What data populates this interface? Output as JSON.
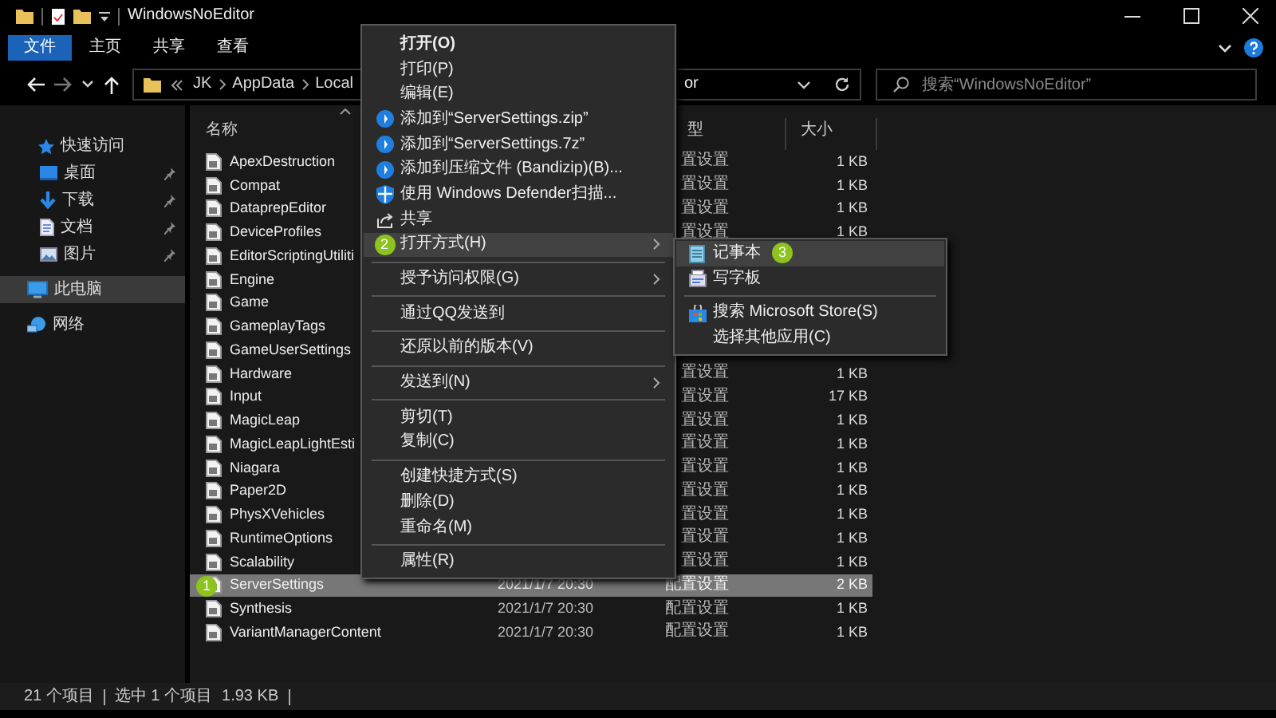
{
  "window": {
    "title": "WindowsNoEditor"
  },
  "ribbon_tabs": [
    {
      "label": "文件",
      "selected": true
    },
    {
      "label": "主页",
      "selected": false
    },
    {
      "label": "共享",
      "selected": false
    },
    {
      "label": "查看",
      "selected": false
    }
  ],
  "address_bar": {
    "breadcrumbs": [
      "JK",
      "AppData",
      "Local"
    ],
    "path_tail": "or"
  },
  "search": {
    "placeholder": "搜索“WindowsNoEditor”"
  },
  "sidebar": {
    "items": [
      {
        "label": "快速访问",
        "selected": false,
        "children": [
          {
            "label": "桌面",
            "pinned": true,
            "selected": false
          },
          {
            "label": "下载",
            "pinned": true,
            "selected": false
          },
          {
            "label": "文档",
            "pinned": true,
            "selected": false
          },
          {
            "label": "图片",
            "pinned": true,
            "selected": false
          }
        ]
      },
      {
        "label": "此电脑",
        "selected": true
      },
      {
        "label": "网络",
        "selected": false
      }
    ]
  },
  "columns": [
    "名称",
    "型",
    "大小"
  ],
  "files": [
    {
      "name": "ApexDestruction",
      "type": "置设置",
      "size": "1 KB",
      "selected": false
    },
    {
      "name": "Compat",
      "type": "置设置",
      "size": "1 KB",
      "selected": false
    },
    {
      "name": "DataprepEditor",
      "type": "置设置",
      "size": "1 KB",
      "selected": false
    },
    {
      "name": "DeviceProfiles",
      "type": "置设置",
      "size": "1 KB",
      "selected": false
    },
    {
      "name": "EditorScriptingUtiliti",
      "selected": false
    },
    {
      "name": "Engine",
      "selected": false
    },
    {
      "name": "Game",
      "selected": false
    },
    {
      "name": "GameplayTags",
      "selected": false
    },
    {
      "name": "GameUserSettings",
      "selected": false
    },
    {
      "name": "Hardware",
      "type": "置设置",
      "size": "1 KB",
      "selected": false
    },
    {
      "name": "Input",
      "type": "置设置",
      "size": "17 KB",
      "selected": false
    },
    {
      "name": "MagicLeap",
      "type": "置设置",
      "size": "1 KB",
      "selected": false
    },
    {
      "name": "MagicLeapLightEsti",
      "type": "置设置",
      "size": "1 KB",
      "selected": false
    },
    {
      "name": "Niagara",
      "type": "置设置",
      "size": "1 KB",
      "selected": false
    },
    {
      "name": "Paper2D",
      "type": "置设置",
      "size": "1 KB",
      "selected": false
    },
    {
      "name": "PhysXVehicles",
      "type": "置设置",
      "size": "1 KB",
      "selected": false
    },
    {
      "name": "RuntimeOptions",
      "type": "置设置",
      "size": "1 KB",
      "selected": false
    },
    {
      "name": "Scalability",
      "type": "置设置",
      "size": "1 KB",
      "selected": false
    },
    {
      "name": "ServerSettings",
      "date": "2021/1/7 20:30",
      "type": "配置设置",
      "size": "2 KB",
      "selected": true,
      "badge": "1"
    },
    {
      "name": "Synthesis",
      "date": "2021/1/7 20:30",
      "type": "配置设置",
      "size": "1 KB",
      "selected": false
    },
    {
      "name": "VariantManagerContent",
      "date": "2021/1/7 20:30",
      "type": "配置设置",
      "size": "1 KB",
      "selected": false
    }
  ],
  "context_menu": {
    "groups": [
      [
        {
          "label": "打开(O)",
          "default": true,
          "selected": false,
          "submenu": false
        },
        {
          "label": "打印(P)",
          "default": false,
          "selected": false,
          "submenu": false
        },
        {
          "label": "编辑(E)",
          "default": false,
          "selected": false,
          "submenu": false
        },
        {
          "label": "添加到“ServerSettings.zip”",
          "default": false,
          "selected": false,
          "submenu": false
        },
        {
          "label": "添加到“ServerSettings.7z”",
          "default": false,
          "selected": false,
          "submenu": false
        },
        {
          "label": "添加到压缩文件 (Bandizip)(B)...",
          "default": false,
          "selected": false,
          "submenu": false
        },
        {
          "label": "使用 Windows Defender扫描...",
          "default": false,
          "selected": false,
          "submenu": false
        },
        {
          "label": "共享",
          "default": false,
          "selected": false,
          "submenu": false
        },
        {
          "label": "打开方式(H)",
          "default": false,
          "selected": true,
          "submenu": true,
          "badge": "2"
        }
      ],
      [
        {
          "label": "授予访问权限(G)",
          "default": false,
          "selected": false,
          "submenu": true
        }
      ],
      [
        {
          "label": "通过QQ发送到",
          "default": false,
          "selected": false,
          "submenu": false
        }
      ],
      [
        {
          "label": "还原以前的版本(V)",
          "default": false,
          "selected": false,
          "submenu": false
        }
      ],
      [
        {
          "label": "发送到(N)",
          "default": false,
          "selected": false,
          "submenu": true
        }
      ],
      [
        {
          "label": "剪切(T)",
          "default": false,
          "selected": false,
          "submenu": false
        },
        {
          "label": "复制(C)",
          "default": false,
          "selected": false,
          "submenu": false
        }
      ],
      [
        {
          "label": "创建快捷方式(S)",
          "default": false,
          "selected": false,
          "submenu": false
        },
        {
          "label": "删除(D)",
          "default": false,
          "selected": false,
          "submenu": false
        },
        {
          "label": "重命名(M)",
          "default": false,
          "selected": false,
          "submenu": false
        }
      ],
      [
        {
          "label": "属性(R)",
          "default": false,
          "selected": false,
          "submenu": false
        }
      ]
    ]
  },
  "open_with_menu": {
    "groups": [
      [
        {
          "label": "记事本",
          "selected": true,
          "badge": "3"
        },
        {
          "label": "写字板",
          "selected": false
        }
      ],
      [
        {
          "label": "搜索 Microsoft Store(S)",
          "selected": false
        },
        {
          "label": "选择其他应用(C)",
          "selected": false
        }
      ]
    ]
  },
  "status_bar": {
    "item_count": "21 个项目",
    "selection": "选中 1 个项目",
    "selection_size": "1.93 KB"
  }
}
